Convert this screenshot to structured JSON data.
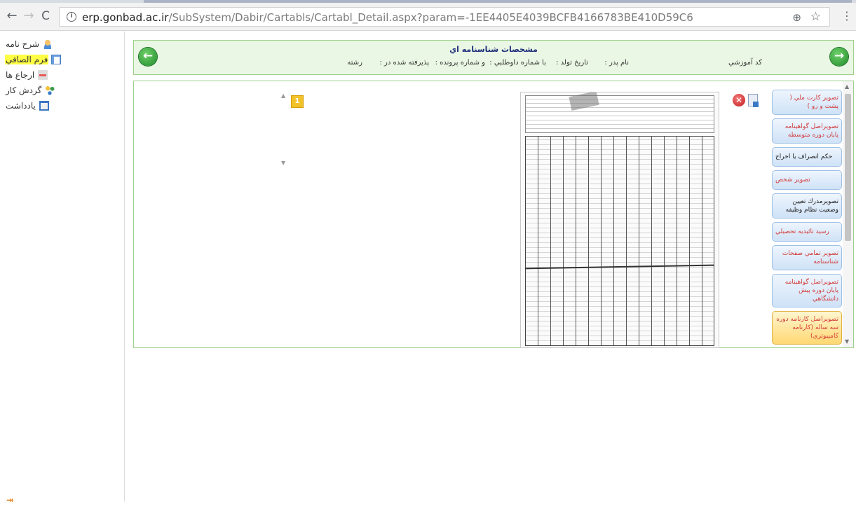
{
  "browser": {
    "url_host": "erp.gonbad.ac.ir",
    "url_path": "/SubSystem/Dabir/Cartabls/Cartabl_Detail.aspx?param=-1EE4405E4039BCFB4166783BE410D59C6"
  },
  "sidebar": {
    "items": [
      {
        "label": "شرح نامه",
        "icon": "person-icon"
      },
      {
        "label": "فرم الصاقي",
        "icon": "document-icon",
        "active": true
      },
      {
        "label": "ارجاع ها",
        "icon": "forward-icon"
      },
      {
        "label": "گردش کار",
        "icon": "workflow-icon"
      },
      {
        "label": "يادداشت",
        "icon": "note-icon"
      }
    ]
  },
  "header": {
    "title": "مشخصات شناسنامه اي",
    "fields": {
      "student_code": "كد آموزشي",
      "father_name": "نام پدر :",
      "birth_date": "تاريخ تولد :",
      "national_id": "با شماره داوطلبي :",
      "case_number": "و شماره پرونده :",
      "accepted_in": "پذيرفته شده در :",
      "major": "رشته"
    }
  },
  "viewer": {
    "page_number": "1"
  },
  "documents": [
    {
      "label": "تصوير كارت ملي ( پشت و رو )",
      "style": "red"
    },
    {
      "label": "تصويراصل گواهينامه پايان دوره متوسطه",
      "style": "red"
    },
    {
      "label": "حكم انصراف يا اخراج",
      "style": "dark"
    },
    {
      "label": "تصوير شخص",
      "style": "red"
    },
    {
      "label": "تصويرمدرك تعيين وضعيت نظام وظيفه",
      "style": "dark"
    },
    {
      "label": "رسيد تائيديه تحصيلي",
      "style": "red"
    },
    {
      "label": "تصوير تمامي صفحات شناسنامه",
      "style": "red"
    },
    {
      "label": "تصويراصل گواهينامه پايان دوره پيش دانشگاهي",
      "style": "red"
    },
    {
      "label": "تصويراصل كارنامه دوره سه ساله (كارنامه كامپيوتري)",
      "style": "selected"
    }
  ]
}
